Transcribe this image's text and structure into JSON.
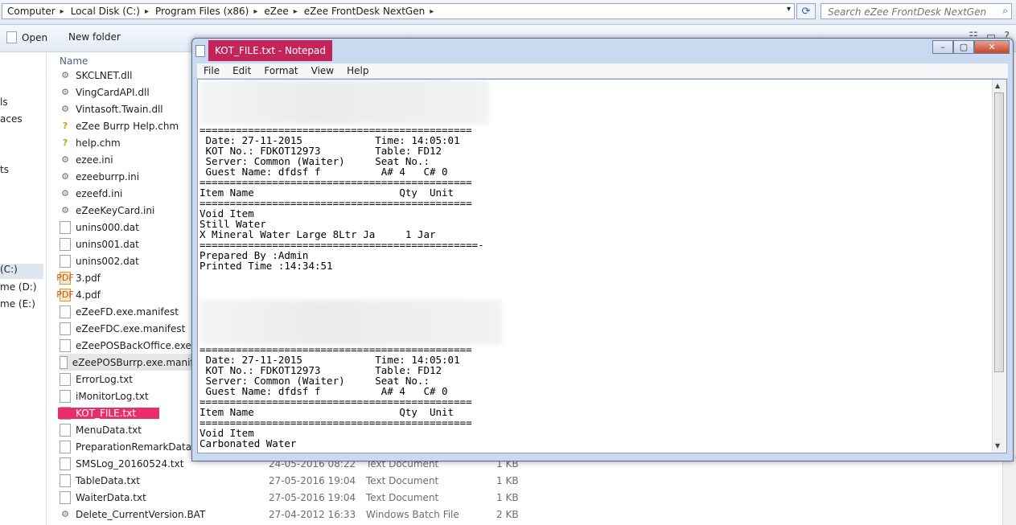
{
  "explorer": {
    "breadcrumb": [
      "Computer",
      "Local Disk (C:)",
      "Program Files (x86)",
      "eZee",
      "eZee FrontDesk NextGen"
    ],
    "search_placeholder": "Search eZee FrontDesk NextGen",
    "toolbar": {
      "open_label": "Open",
      "new_folder_label": "New folder"
    },
    "nav_items": [
      {
        "label": "ls"
      },
      {
        "label": "aces"
      },
      {
        "label": "ts"
      },
      {
        "label": "(C:)"
      },
      {
        "label": "me (D:)"
      },
      {
        "label": "me (E:)"
      }
    ],
    "column_name": "Name",
    "files": [
      {
        "name": "SKCLNET.dll",
        "icon": "dll-icon",
        "date": "",
        "type": "",
        "size": ""
      },
      {
        "name": "VingCardAPI.dll",
        "icon": "dll-icon",
        "date": "",
        "type": "",
        "size": ""
      },
      {
        "name": "Vintasoft.Twain.dll",
        "icon": "dll-icon",
        "date": "",
        "type": "",
        "size": ""
      },
      {
        "name": "eZee Burrp Help.chm",
        "icon": "chm-icon",
        "date": "",
        "type": "",
        "size": ""
      },
      {
        "name": "help.chm",
        "icon": "chm-icon",
        "date": "",
        "type": "",
        "size": ""
      },
      {
        "name": "ezee.ini",
        "icon": "ini-icon",
        "date": "",
        "type": "",
        "size": ""
      },
      {
        "name": "ezeeburrp.ini",
        "icon": "ini-icon",
        "date": "",
        "type": "",
        "size": ""
      },
      {
        "name": "ezeefd.ini",
        "icon": "ini-icon",
        "date": "",
        "type": "",
        "size": ""
      },
      {
        "name": "eZeeKeyCard.ini",
        "icon": "ini-icon",
        "date": "",
        "type": "",
        "size": ""
      },
      {
        "name": "unins000.dat",
        "icon": "file-icon",
        "date": "",
        "type": "",
        "size": ""
      },
      {
        "name": "unins001.dat",
        "icon": "file-icon",
        "date": "",
        "type": "",
        "size": ""
      },
      {
        "name": "unins002.dat",
        "icon": "file-icon",
        "date": "",
        "type": "",
        "size": ""
      },
      {
        "name": "3.pdf",
        "icon": "pdf-icon",
        "date": "",
        "type": "",
        "size": ""
      },
      {
        "name": "4.pdf",
        "icon": "pdf-icon",
        "date": "",
        "type": "",
        "size": ""
      },
      {
        "name": "eZeeFD.exe.manifest",
        "icon": "file-icon",
        "date": "",
        "type": "",
        "size": ""
      },
      {
        "name": "eZeeFDC.exe.manifest",
        "icon": "file-icon",
        "date": "",
        "type": "",
        "size": ""
      },
      {
        "name": "eZeePOSBackOffice.exe.manifest",
        "icon": "file-icon",
        "date": "",
        "type": "",
        "size": ""
      },
      {
        "name": "eZeePOSBurrp.exe.manifest",
        "icon": "file-icon",
        "date": "",
        "type": "",
        "size": ""
      },
      {
        "name": "ErrorLog.txt",
        "icon": "text-file-icon",
        "date": "",
        "type": "",
        "size": ""
      },
      {
        "name": "iMonitorLog.txt",
        "icon": "text-file-icon",
        "date": "",
        "type": "",
        "size": ""
      },
      {
        "name": "KOT_FILE.txt",
        "icon": "text-file-icon",
        "date": "",
        "type": "",
        "size": ""
      },
      {
        "name": "MenuData.txt",
        "icon": "text-file-icon",
        "date": "",
        "type": "",
        "size": ""
      },
      {
        "name": "PreparationRemarkData.txt",
        "icon": "text-file-icon",
        "date": "",
        "type": "",
        "size": ""
      },
      {
        "name": "SMSLog_20160524.txt",
        "icon": "text-file-icon",
        "date": "24-05-2016 08:22",
        "type": "Text Document",
        "size": "1 KB"
      },
      {
        "name": "TableData.txt",
        "icon": "text-file-icon",
        "date": "27-05-2016 19:04",
        "type": "Text Document",
        "size": "1 KB"
      },
      {
        "name": "WaiterData.txt",
        "icon": "text-file-icon",
        "date": "27-05-2016 19:04",
        "type": "Text Document",
        "size": "1 KB"
      },
      {
        "name": "Delete_CurrentVersion.BAT",
        "icon": "batch-file-icon",
        "date": "27-04-2012 16:33",
        "type": "Windows Batch File",
        "size": "2 KB"
      }
    ],
    "highlight_color": "#ea2e6b"
  },
  "notepad": {
    "title": "KOT_FILE.txt - Notepad",
    "menu": [
      "File",
      "Edit",
      "Format",
      "View",
      "Help"
    ],
    "content_block1": "=============================================\n Date: 27-11-2015            Time: 14:05:01\n KOT No.: FDKOT12973         Table: FD12\n Server: Common (Waiter)     Seat No.:\n Guest Name: dfdsf f          A# 4   C# 0\n=============================================\nItem Name                        Qty  Unit\n=============================================\nVoid Item\nStill Water\nX Mineral Water Large 8Ltr Ja     1 Jar\n==============================================-\nPrepared By :Admin\nPrinted Time :14:34:51",
    "content_block2": "=============================================\n Date: 27-11-2015            Time: 14:05:01\n KOT No.: FDKOT12973         Table: FD12\n Server: Common (Waiter)     Seat No.:\n Guest Name: dfdsf f          A# 4   C# 0\n=============================================\nItem Name                        Qty  Unit\n=============================================\nVoid Item\nCarbonated Water",
    "title_color": "#c3245a"
  }
}
